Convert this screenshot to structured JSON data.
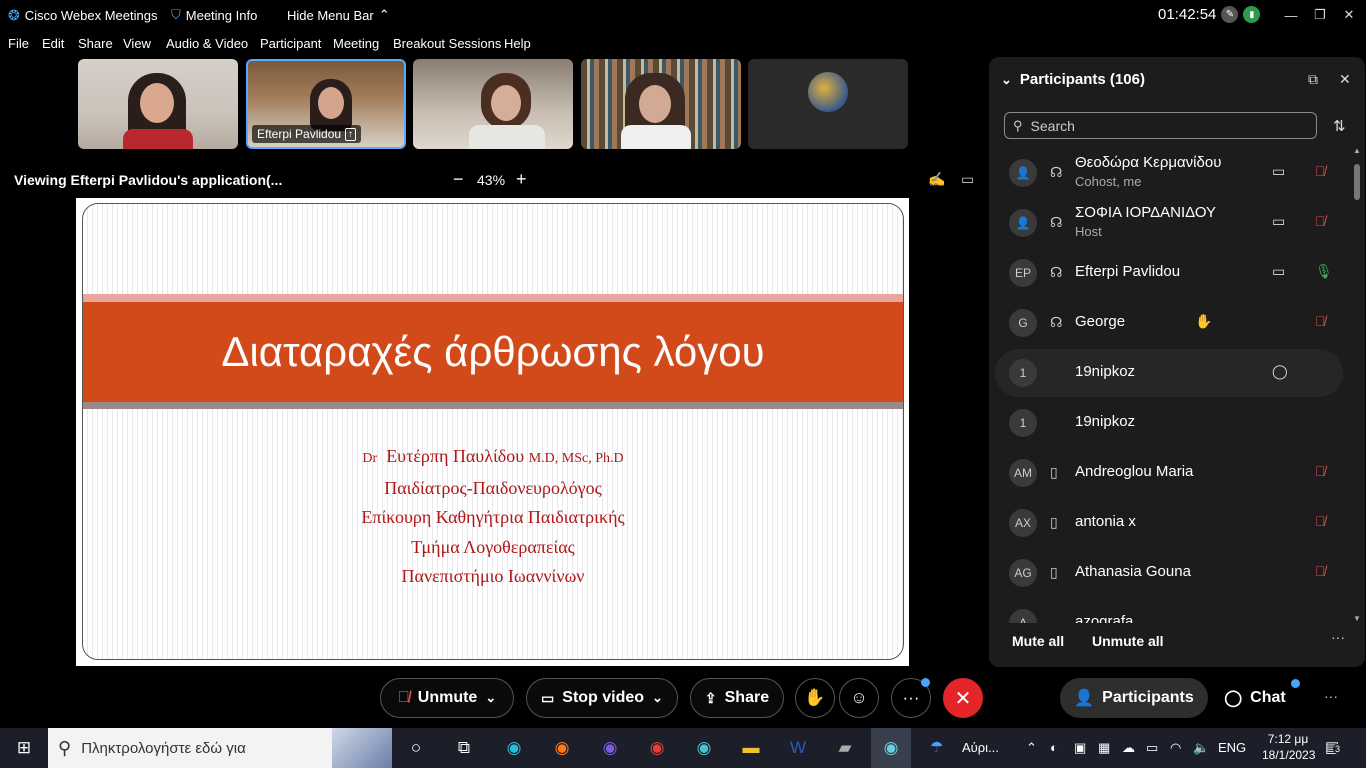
{
  "titlebar": {
    "app_title": "Cisco Webex Meetings",
    "meeting_info": "Meeting Info",
    "hide_menu": "Hide Menu Bar",
    "time": "01:42:54"
  },
  "menu": [
    "File",
    "Edit",
    "Share",
    "View",
    "Audio & Video",
    "Participant",
    "Meeting",
    "Breakout Sessions",
    "Help"
  ],
  "thumbnails": [
    {
      "name": ""
    },
    {
      "name": "Efterpi Pavlidou"
    },
    {
      "name": ""
    },
    {
      "name": ""
    },
    {
      "name": ""
    }
  ],
  "viewing": {
    "label": "Viewing Efterpi Pavlidou's application(...",
    "zoom": "43%"
  },
  "slide": {
    "title": "Διαταραχές άρθρωσης λόγου",
    "line1_prefix": "Dr",
    "line1_name": "Ευτέρπη Παυλίδου",
    "line1_suffix": "M.D, MSc, Ph.D",
    "line2": "Παιδίατρος-Παιδονευρολόγος",
    "line3": "Επίκουρη Καθηγήτρια Παιδιατρικής",
    "line4": "Τμήμα Λογοθεραπείας",
    "line5": "Πανεπιστήμιο Ιωαννίνων"
  },
  "participants_panel": {
    "header": "Participants (106)",
    "search_placeholder": "Search",
    "mute_all": "Mute all",
    "unmute_all": "Unmute all",
    "people": [
      {
        "avatar": "",
        "name": "Θεοδώρα Κερμανίδου",
        "role": "Cohost, me",
        "audio": "muted"
      },
      {
        "avatar": "",
        "name": "ΣΟΦΙΑ ΙΟΡΔΑΝΙΔΟΥ",
        "role": "Host",
        "audio": "muted"
      },
      {
        "avatar": "EP",
        "name": "Efterpi Pavlidou",
        "role": "",
        "audio": "unmuted"
      },
      {
        "avatar": "G",
        "name": "George",
        "role": "",
        "audio": "muted"
      },
      {
        "avatar": "1",
        "name": "19nipkoz",
        "role": "",
        "audio": "chat"
      },
      {
        "avatar": "1",
        "name": "19nipkoz",
        "role": "",
        "audio": "none"
      },
      {
        "avatar": "AM",
        "name": "Andreoglou Maria",
        "role": "",
        "audio": "muted"
      },
      {
        "avatar": "AX",
        "name": "antonia x",
        "role": "",
        "audio": "muted"
      },
      {
        "avatar": "AG",
        "name": "Athanasia Gouna",
        "role": "",
        "audio": "muted"
      },
      {
        "avatar": "A",
        "name": "azografa",
        "role": "",
        "audio": "none"
      }
    ]
  },
  "controls": {
    "unmute": "Unmute",
    "stop_video": "Stop video",
    "share": "Share",
    "participants": "Participants",
    "chat": "Chat"
  },
  "taskbar": {
    "search_placeholder": "Πληκτρολογήστε εδώ για",
    "weather": "Αύρι...",
    "lang": "ENG",
    "time": "7:12 μμ",
    "date": "18/1/2023",
    "notif_count": "3"
  },
  "colors": {
    "accent_red": "#e0504a",
    "slide_band": "#d24a1a",
    "slide_text": "#b01818",
    "end_button": "#e5252a"
  }
}
